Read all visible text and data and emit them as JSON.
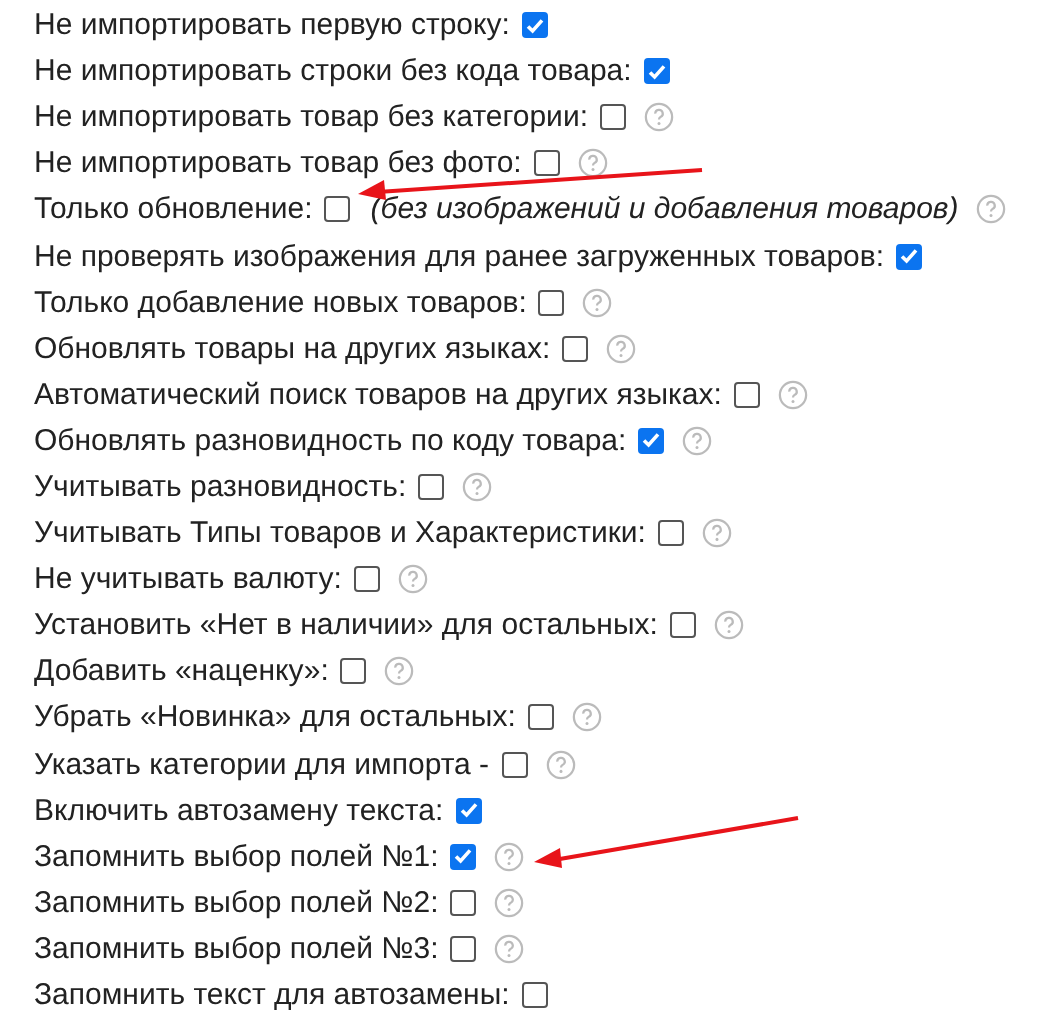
{
  "options": [
    {
      "label": "Не импортировать первую строку:",
      "checked": true,
      "help": false
    },
    {
      "label": "Не импортировать строки без кода товара:",
      "checked": true,
      "help": false
    },
    {
      "label": "Не импортировать товар без категории:",
      "checked": false,
      "help": true
    },
    {
      "label": "Не импортировать товар без фото:",
      "checked": false,
      "help": true
    },
    {
      "label": "Только обновление:",
      "checked": false,
      "help": true,
      "note": "(без изображений и добавления товаров)",
      "arrow_to_checkbox": true
    },
    {
      "label": "Не проверять изображения для ранее загруженных товаров:",
      "checked": true,
      "help": false
    },
    {
      "label": "Только добавление новых товаров:",
      "checked": false,
      "help": true
    },
    {
      "label": "Обновлять товары на других языках:",
      "checked": false,
      "help": true
    },
    {
      "label": "Автоматический поиск товаров на других языках:",
      "checked": false,
      "help": true
    },
    {
      "label": "Обновлять разновидность по коду товара:",
      "checked": true,
      "help": true
    },
    {
      "label": "Учитывать разновидность:",
      "checked": false,
      "help": true
    },
    {
      "label": "Учитывать Типы товаров и Характеристики:",
      "checked": false,
      "help": true
    },
    {
      "label": "Не учитывать валюту:",
      "checked": false,
      "help": true
    },
    {
      "label": "Установить «Нет в наличии» для остальных:",
      "checked": false,
      "help": true
    },
    {
      "label": "Добавить «наценку»:",
      "checked": false,
      "help": true
    },
    {
      "label": "Убрать «Новинка» для остальных:",
      "checked": false,
      "help": true
    },
    {
      "label": "Указать категории для импорта -",
      "checked": false,
      "help": true
    },
    {
      "label": "Включить автозамену текста:",
      "checked": true,
      "help": false
    },
    {
      "label": "Запомнить выбор полей №1:",
      "checked": true,
      "help": true,
      "arrow_to_help": true
    },
    {
      "label": "Запомнить выбор полей №2:",
      "checked": false,
      "help": true
    },
    {
      "label": "Запомнить выбор полей №3:",
      "checked": false,
      "help": true
    },
    {
      "label": "Запомнить текст для автозамены:",
      "checked": false,
      "help": false
    }
  ]
}
